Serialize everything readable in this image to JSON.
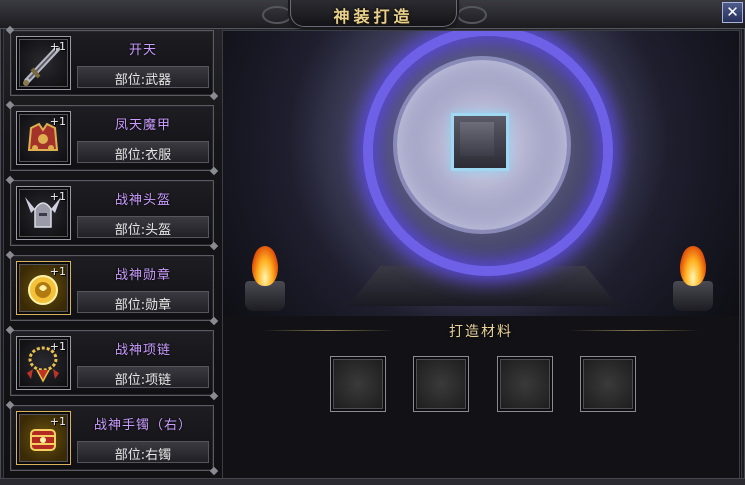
{
  "window": {
    "title": "神装打造",
    "close_symbol": "✕"
  },
  "equipment_list": [
    {
      "name": "开天",
      "slot": "部位:武器",
      "level": "+1",
      "icon": "sword-icon",
      "icon_bg": "dark"
    },
    {
      "name": "凤天魔甲",
      "slot": "部位:衣服",
      "level": "+1",
      "icon": "armor-icon",
      "icon_bg": "dark"
    },
    {
      "name": "战神头盔",
      "slot": "部位:头盔",
      "level": "+1",
      "icon": "helmet-icon",
      "icon_bg": "dark"
    },
    {
      "name": "战神勋章",
      "slot": "部位:勋章",
      "level": "+1",
      "icon": "medal-icon",
      "icon_bg": "gold"
    },
    {
      "name": "战神项链",
      "slot": "部位:项链",
      "level": "+1",
      "icon": "necklace-icon",
      "icon_bg": "dark"
    },
    {
      "name": "战神手镯（右）",
      "slot": "部位:右镯",
      "level": "+1",
      "icon": "bracelet-icon",
      "icon_bg": "gold"
    }
  ],
  "forge": {
    "materials_label": "打造材料",
    "material_slot_count": 4
  },
  "colors": {
    "item_name": "#c99cff",
    "title_gold": "#ead28e",
    "portal_glow": "#6f60e8"
  }
}
